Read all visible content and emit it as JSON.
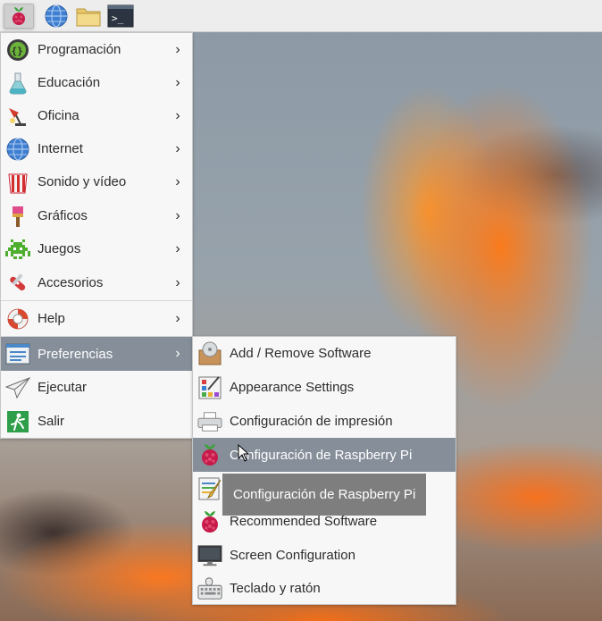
{
  "menu_items": [
    {
      "label": "Programación",
      "icon": "programming-icon"
    },
    {
      "label": "Educación",
      "icon": "education-icon"
    },
    {
      "label": "Oficina",
      "icon": "office-icon"
    },
    {
      "label": "Internet",
      "icon": "internet-globe-icon"
    },
    {
      "label": "Sonido y vídeo",
      "icon": "sound-video-icon"
    },
    {
      "label": "Gráficos",
      "icon": "graphics-paintbrush-icon"
    },
    {
      "label": "Juegos",
      "icon": "games-invader-icon"
    },
    {
      "label": "Accesorios",
      "icon": "accessories-knife-icon"
    },
    {
      "label": "Help",
      "icon": "help-lifebuoy-icon"
    },
    {
      "label": "Preferencias",
      "icon": "preferences-icon"
    },
    {
      "label": "Ejecutar",
      "icon": "run-paperplane-icon"
    },
    {
      "label": "Salir",
      "icon": "logout-exit-icon"
    }
  ],
  "submenu_items": [
    {
      "label": "Add / Remove Software",
      "icon": "add-remove-software-icon"
    },
    {
      "label": "Appearance Settings",
      "icon": "appearance-settings-icon"
    },
    {
      "label": "Configuración de impresión",
      "icon": "printer-icon"
    },
    {
      "label": "Configuración de Raspberry Pi",
      "icon": "raspberry-icon"
    },
    {
      "label": "",
      "icon": "main-menu-editor-icon"
    },
    {
      "label": "Recommended Software",
      "icon": "raspberry-icon"
    },
    {
      "label": "Screen Configuration",
      "icon": "monitor-icon"
    },
    {
      "label": "Teclado y ratón",
      "icon": "keyboard-mouse-icon"
    }
  ],
  "tooltip": "Configuración de Raspberry Pi",
  "active_menu": "Preferencias",
  "hovered_submenu_item": "Configuración de Raspberry Pi",
  "colors": {
    "highlight": "#858e99",
    "menu_bg": "#f7f7f7",
    "panel_bg": "#ededed",
    "tooltip_bg": "#7b7b7b"
  }
}
